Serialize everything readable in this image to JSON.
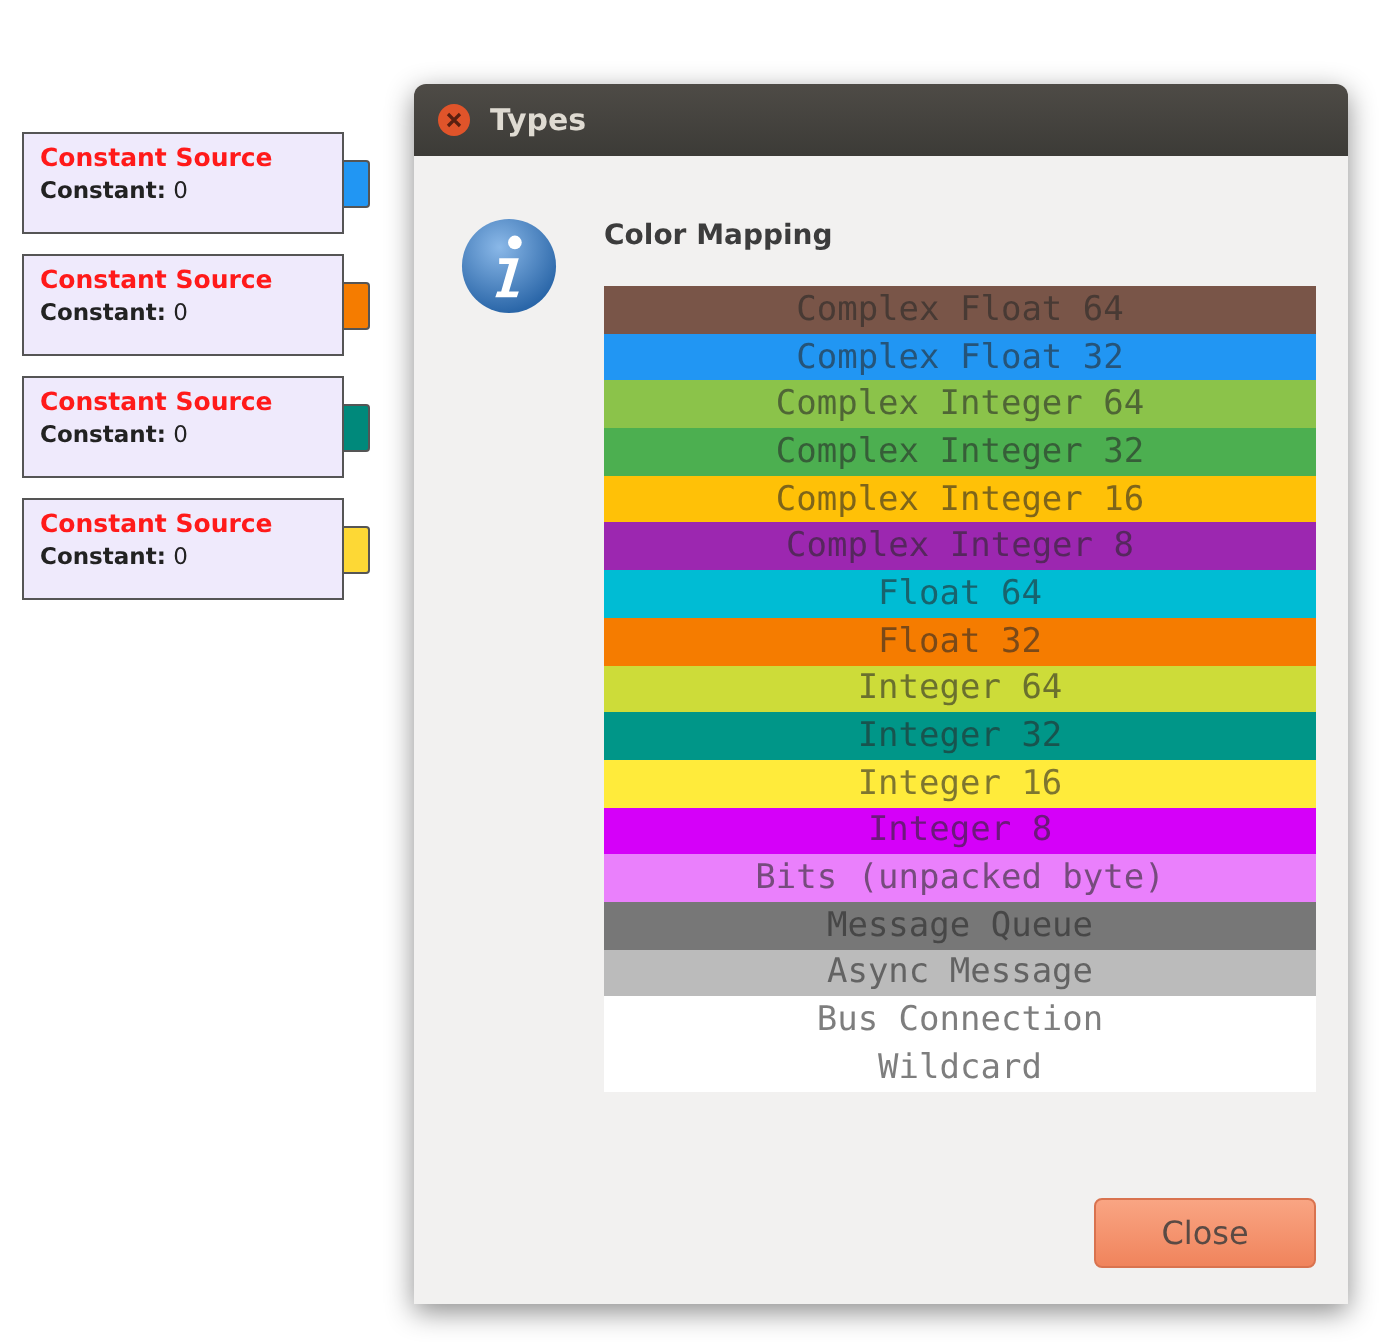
{
  "blocks": [
    {
      "title": "Constant Source",
      "param_label": "Constant:",
      "param_value": "0",
      "color": "#2196f3"
    },
    {
      "title": "Constant Source",
      "param_label": "Constant:",
      "param_value": "0",
      "color": "#f57c00"
    },
    {
      "title": "Constant Source",
      "param_label": "Constant:",
      "param_value": "0",
      "color": "#00897b"
    },
    {
      "title": "Constant Source",
      "param_label": "Constant:",
      "param_value": "0",
      "color": "#fdd835"
    }
  ],
  "dialog": {
    "title": "Types",
    "heading": "Color Mapping",
    "button": "Close",
    "types": [
      {
        "label": "Complex Float 64",
        "color": "#795548"
      },
      {
        "label": "Complex Float 32",
        "color": "#2196f3"
      },
      {
        "label": "Complex Integer 64",
        "color": "#8bc34a"
      },
      {
        "label": "Complex Integer 32",
        "color": "#4caf50"
      },
      {
        "label": "Complex Integer 16",
        "color": "#ffc107"
      },
      {
        "label": "Complex Integer 8",
        "color": "#9c27b0"
      },
      {
        "label": "Float 64",
        "color": "#00bcd4"
      },
      {
        "label": "Float 32",
        "color": "#f57c00"
      },
      {
        "label": "Integer 64",
        "color": "#cddc39"
      },
      {
        "label": "Integer 32",
        "color": "#009688"
      },
      {
        "label": "Integer 16",
        "color": "#ffeb3b"
      },
      {
        "label": "Integer 8",
        "color": "#d500f9"
      },
      {
        "label": "Bits (unpacked byte)",
        "color": "#ea80fc"
      },
      {
        "label": "Message Queue",
        "color": "#777777"
      },
      {
        "label": "Async Message",
        "color": "#bbbbbb"
      },
      {
        "label": "Bus Connection",
        "color": "#ffffff"
      },
      {
        "label": "Wildcard",
        "color": "#ffffff"
      }
    ]
  }
}
